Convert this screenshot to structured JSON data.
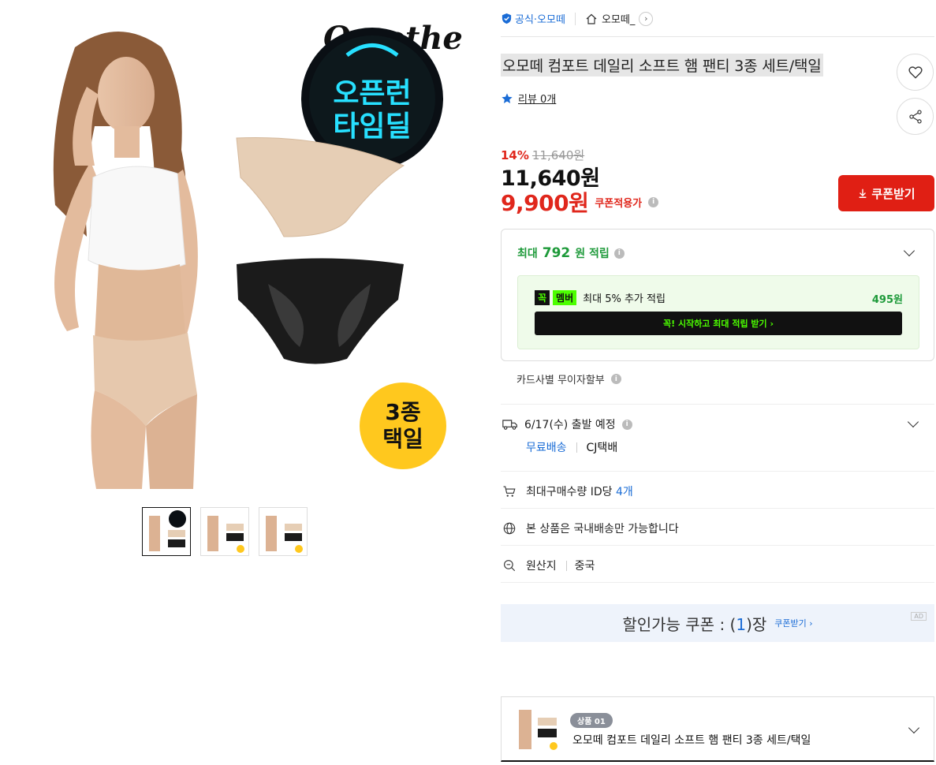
{
  "store": {
    "official_label": "공식·오모떼",
    "name": "오모떼_"
  },
  "product": {
    "title": "오모떼 컴포트 데일리 소프트 햄 팬티 3종 세트/택일",
    "review_label": "리뷰 0개",
    "discount_pct": "14%",
    "orig_price": "11,640원",
    "price": "11,640원",
    "coupon_price": "9,900원",
    "coupon_price_label": "쿠폰적용가"
  },
  "image_text": {
    "brand": "Omothe",
    "badge_line1": "오픈런",
    "badge_line2": "타임딜",
    "circle_line1": "3종",
    "circle_line2": "택일"
  },
  "coupon_button": {
    "label": "쿠폰받기"
  },
  "points": {
    "prefix": "최대",
    "amount": "792",
    "suffix": "원 적립",
    "member_tag1": "꼭",
    "member_tag2": "멤버",
    "member_text": "최대 5% 추가 적립",
    "member_amount": "495원",
    "member_cta": "꼭! 시작하고 최대 적립 받기 ›"
  },
  "card_installment": "카드사별 무이자할부",
  "shipping": {
    "date": "6/17(수) 출발 예정",
    "free": "무료배송",
    "courier": "CJ택배"
  },
  "max_qty": {
    "label": "최대구매수량 ID당",
    "value": "4개"
  },
  "domestic": "본 상품은 국내배송만 가능합니다",
  "origin": {
    "label": "원산지",
    "value": "중국"
  },
  "coupon_banner": {
    "prefix": "할인가능 쿠폰 : (",
    "count": "1",
    "suffix": ")장",
    "link": "쿠폰받기 ›",
    "ad": "AD"
  },
  "option": {
    "pill": "상품 01",
    "name": "오모떼 컴포트 데일리 소프트 햄 팬티 3종 세트/택일"
  },
  "colors": {
    "accent_red": "#e0271c",
    "accent_green": "#1e9a3a",
    "accent_blue": "#1a6cd6",
    "neon": "#4cff00"
  }
}
